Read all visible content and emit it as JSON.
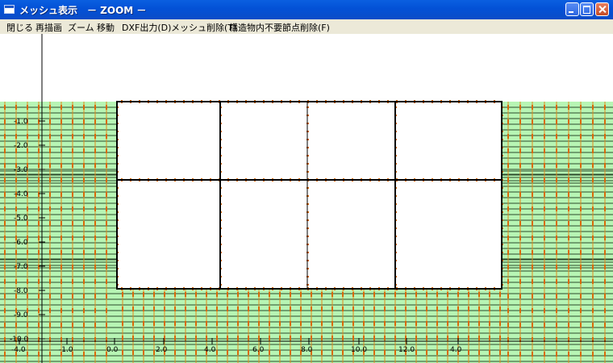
{
  "window": {
    "title": "メッシュ表示　－ ZOOM －"
  },
  "menu": [
    {
      "label": "閉じる"
    },
    {
      "label": "再描画"
    },
    {
      "label": "ズーム"
    },
    {
      "label": "移動"
    },
    {
      "label": "DXF出力(D)"
    },
    {
      "label": "メッシュ削除(T)"
    },
    {
      "label": "構造物内不要節点削除(F)"
    }
  ],
  "axes": {
    "y_ticks": [
      "-1.0",
      "-2.0",
      "-3.0",
      "-4.0",
      "-5.0",
      "-6.0",
      "-7.0",
      "-8.0",
      "-9.0",
      "-10.0"
    ],
    "x_ticks": [
      "-4.0",
      "-1.0",
      "0.0",
      "2.0",
      "4.0",
      "6.0",
      "8.0",
      "10.0",
      "12.0",
      "4.0"
    ]
  },
  "colors": {
    "mesh_fill": "#b7f5b4",
    "mesh_line": "#2b4a2b",
    "node": "#e07b10",
    "structure_outline": "#000000",
    "background": "#ffffff"
  }
}
